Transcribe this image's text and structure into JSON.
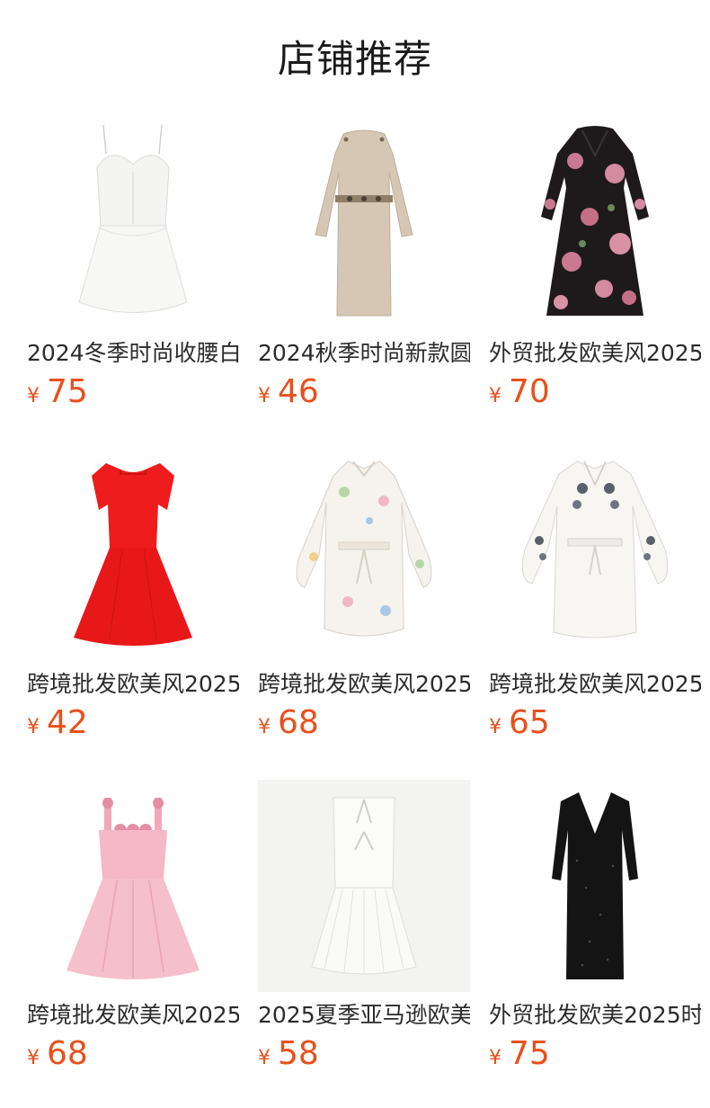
{
  "section": {
    "title": "店铺推荐"
  },
  "currency_symbol": "¥",
  "colors": {
    "price": "#e8501c",
    "title": "#1a1a1a",
    "text": "#2b2b2b"
  },
  "products": [
    {
      "name": "2024冬季时尚收腰白",
      "price": "75",
      "image_icon": "white-corset-dress"
    },
    {
      "name": "2024秋季时尚新款圆",
      "price": "46",
      "image_icon": "beige-knit-dress"
    },
    {
      "name": "外贸批发欧美风2025",
      "price": "70",
      "image_icon": "floral-maxi-dress"
    },
    {
      "name": "跨境批发欧美风2025",
      "price": "42",
      "image_icon": "red-mini-dress"
    },
    {
      "name": "跨境批发欧美风2025",
      "price": "68",
      "image_icon": "embroidered-white-dress"
    },
    {
      "name": "跨境批发欧美风2025",
      "price": "65",
      "image_icon": "embroidered-sleeve-dress"
    },
    {
      "name": "跨境批发欧美风2025",
      "price": "68",
      "image_icon": "pink-rose-strap-dress"
    },
    {
      "name": "2025夏季亚马逊欧美",
      "price": "58",
      "image_icon": "white-pleated-dress"
    },
    {
      "name": "外贸批发欧美2025时",
      "price": "75",
      "image_icon": "black-sequin-dress"
    }
  ]
}
